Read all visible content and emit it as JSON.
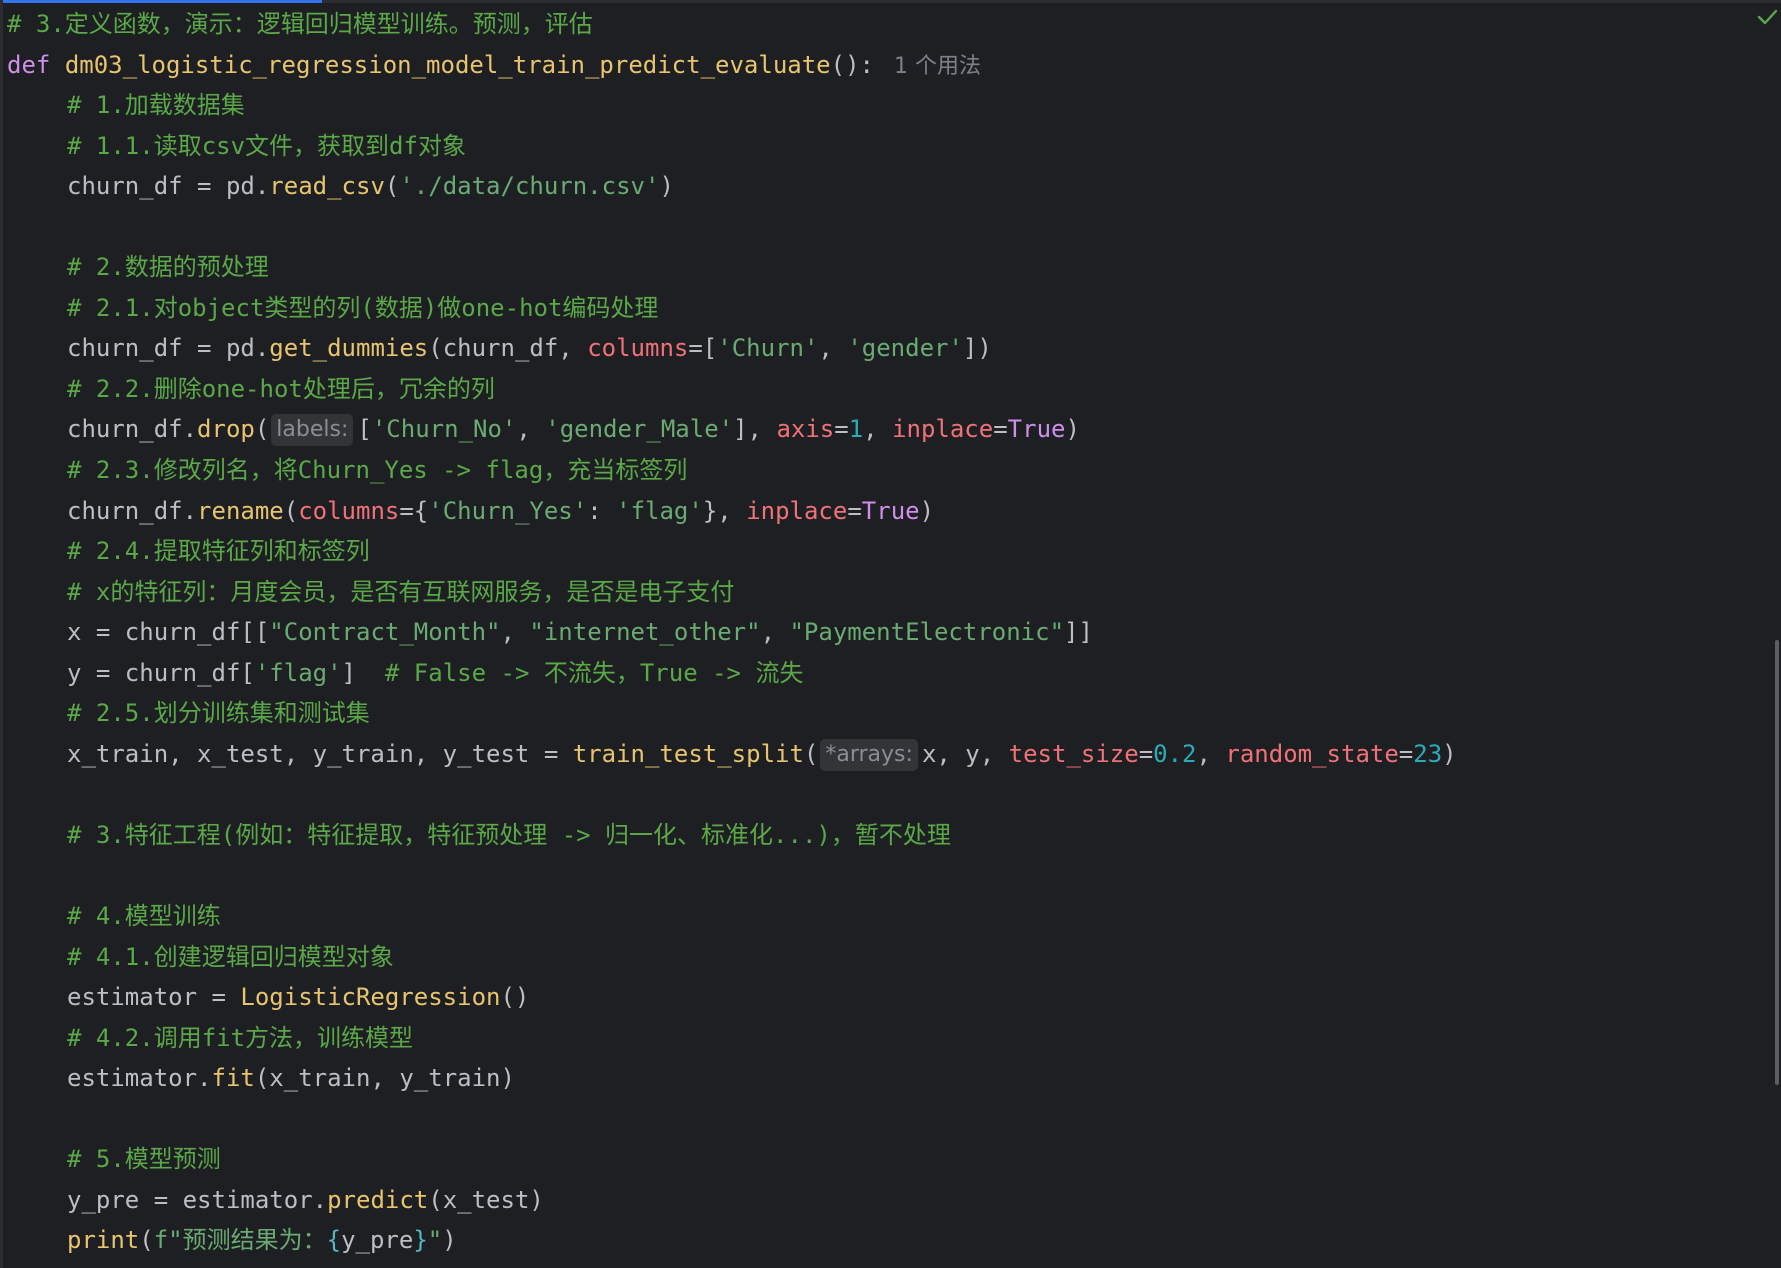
{
  "editor": {
    "usage_hint": "1 个用法",
    "lines": {
      "l01": "# 3.定义函数，演示：逻辑回归模型训练。预测，评估",
      "l02_kw": "def",
      "l02_fn": "dm03_logistic_regression_model_train_predict_evaluate",
      "l02_rest": "():",
      "l03": "# 1.加载数据集",
      "l04": "# 1.1.读取csv文件，获取到df对象",
      "l05_a": "churn_df = pd.",
      "l05_fn": "read_csv",
      "l05_b": "(",
      "l05_str": "'./data/churn.csv'",
      "l05_c": ")",
      "l07": "# 2.数据的预处理",
      "l08": "# 2.1.对object类型的列(数据)做one-hot编码处理",
      "l09_a": "churn_df = pd.",
      "l09_fn": "get_dummies",
      "l09_b": "(churn_df, ",
      "l09_param": "columns",
      "l09_c": "=[",
      "l09_s1": "'Churn'",
      "l09_d": ", ",
      "l09_s2": "'gender'",
      "l09_e": "])",
      "l10": "# 2.2.删除one-hot处理后，冗余的列",
      "l11_a": "churn_df.",
      "l11_fn": "drop",
      "l11_b": "(",
      "l11_hint": "labels:",
      "l11_c": "[",
      "l11_s1": "'Churn_No'",
      "l11_d": ", ",
      "l11_s2": "'gender_Male'",
      "l11_e": "], ",
      "l11_p1": "axis",
      "l11_f": "=",
      "l11_n1": "1",
      "l11_g": ", ",
      "l11_p2": "inplace",
      "l11_h": "=",
      "l11_bool": "True",
      "l11_i": ")",
      "l12": "# 2.3.修改列名，将Churn_Yes -> flag，充当标签列",
      "l13_a": "churn_df.",
      "l13_fn": "rename",
      "l13_b": "(",
      "l13_p1": "columns",
      "l13_c": "={",
      "l13_s1": "'Churn_Yes'",
      "l13_d": ": ",
      "l13_s2": "'flag'",
      "l13_e": "}, ",
      "l13_p2": "inplace",
      "l13_f": "=",
      "l13_bool": "True",
      "l13_g": ")",
      "l14": "# 2.4.提取特征列和标签列",
      "l15": "# x的特征列：月度会员，是否有互联网服务，是否是电子支付",
      "l16_a": "x = churn_df[[",
      "l16_s1": "\"Contract_Month\"",
      "l16_b": ", ",
      "l16_s2": "\"internet_other\"",
      "l16_c": ", ",
      "l16_s3": "\"PaymentElectronic\"",
      "l16_d": "]]",
      "l17_a": "y = churn_df[",
      "l17_s1": "'flag'",
      "l17_b": "]  ",
      "l17_comment": "# False -> 不流失，True -> 流失",
      "l18": "# 2.5.划分训练集和测试集",
      "l19_a": "x_train, x_test, y_train, y_test = ",
      "l19_fn": "train_test_split",
      "l19_b": "(",
      "l19_hint": "*arrays:",
      "l19_c": "x, y, ",
      "l19_p1": "test_size",
      "l19_d": "=",
      "l19_n1": "0.2",
      "l19_e": ", ",
      "l19_p2": "random_state",
      "l19_f": "=",
      "l19_n2": "23",
      "l19_g": ")",
      "l21": "# 3.特征工程(例如：特征提取，特征预处理 -> 归一化、标准化...)，暂不处理",
      "l23": "# 4.模型训练",
      "l24": "# 4.1.创建逻辑回归模型对象",
      "l25_a": "estimator = ",
      "l25_fn": "LogisticRegression",
      "l25_b": "()",
      "l26": "# 4.2.调用fit方法，训练模型",
      "l27_a": "estimator.",
      "l27_fn": "fit",
      "l27_b": "(x_train, y_train)",
      "l29": "# 5.模型预测",
      "l30_a": "y_pre = estimator.",
      "l30_fn": "predict",
      "l30_b": "(x_test)",
      "l31_fn": "print",
      "l31_a": "(",
      "l31_s1": "f\"预测结果为：",
      "l31_br1": "{",
      "l31_var": "y_pre",
      "l31_br2": "}",
      "l31_s2": "\"",
      "l31_b": ")"
    }
  },
  "colors": {
    "background": "#1e1f22",
    "comment": "#5aa848",
    "keyword": "#cf8ee8",
    "function": "#e8c46e",
    "string": "#6aab73",
    "parameter": "#f07178",
    "number": "#2aacb8",
    "default_text": "#bcbec4",
    "accent": "#3574f0"
  },
  "icons": {
    "status": "check-icon"
  }
}
